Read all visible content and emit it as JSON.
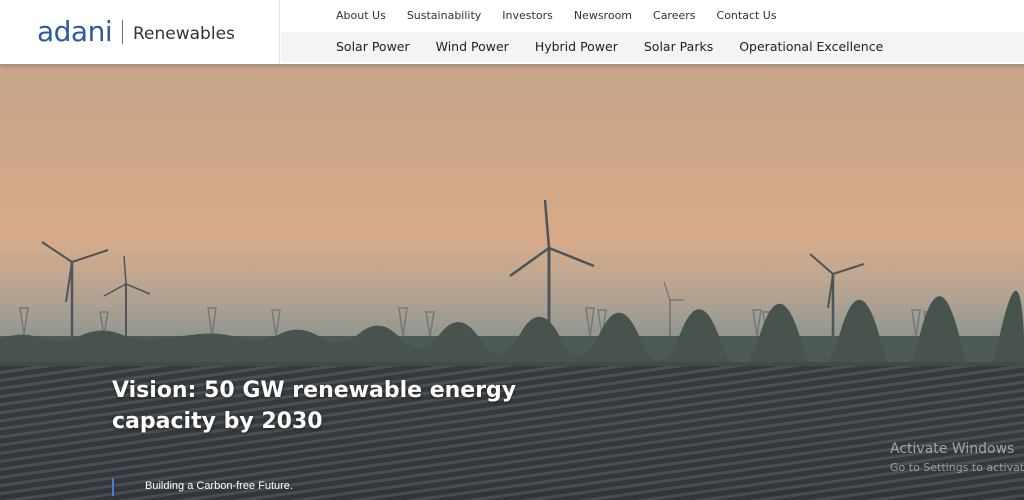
{
  "brand": {
    "logo_text": "adani",
    "logo_sub": "Renewables",
    "colors": {
      "adani_blue": "#2d5aa0",
      "adani_purple": "#6b3fa0",
      "accent_bar": "#4a7fd0"
    }
  },
  "top_links": [
    "About Us",
    "Sustainability",
    "Investors",
    "Newsroom",
    "Careers",
    "Contact Us"
  ],
  "main_nav": [
    "Solar Power",
    "Wind Power",
    "Hybrid Power",
    "Solar Parks",
    "Operational Excellence"
  ],
  "hero": {
    "title": "Vision: 50 GW renewable energy capacity by 2030",
    "subtitle": "Building a Carbon-free Future.",
    "image_icon": "wind-solar-landscape-image"
  },
  "system_watermark": {
    "line1": "Activate Windows",
    "line2": "Go to Settings to activat"
  }
}
